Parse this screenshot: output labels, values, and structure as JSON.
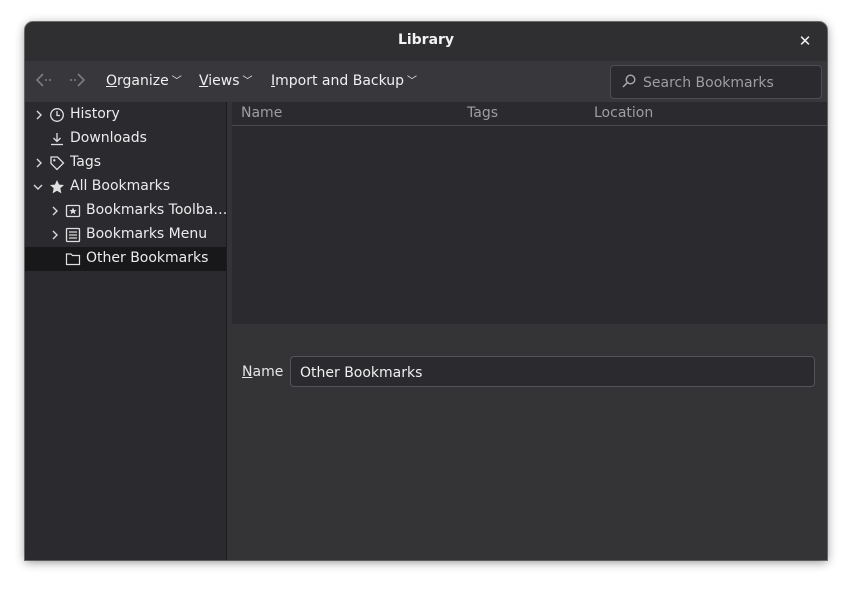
{
  "window": {
    "title": "Library"
  },
  "toolbar": {
    "organize": {
      "mnemonic": "O",
      "rest": "rganize"
    },
    "views": {
      "mnemonic": "V",
      "rest": "iews"
    },
    "import_backup": {
      "mnemonic": "I",
      "rest": "mport and Backup"
    },
    "search_placeholder": "Search Bookmarks"
  },
  "sidebar": {
    "items": [
      {
        "label": "History",
        "icon": "clock-icon",
        "expandable": true,
        "expanded": false
      },
      {
        "label": "Downloads",
        "icon": "download-icon",
        "expandable": false
      },
      {
        "label": "Tags",
        "icon": "tag-icon",
        "expandable": true,
        "expanded": false
      },
      {
        "label": "All Bookmarks",
        "icon": "star-icon",
        "expandable": true,
        "expanded": true
      },
      {
        "label": "Bookmarks Toolba…",
        "icon": "bookmarks-toolbar-icon",
        "expandable": true,
        "expanded": false
      },
      {
        "label": "Bookmarks Menu",
        "icon": "bookmarks-menu-icon",
        "expandable": true,
        "expanded": false
      },
      {
        "label": "Other Bookmarks",
        "icon": "folder-icon",
        "expandable": false,
        "selected": true
      }
    ]
  },
  "list": {
    "columns": [
      "Name",
      "Tags",
      "Location"
    ],
    "rows": []
  },
  "details": {
    "name_label": {
      "mnemonic": "N",
      "rest": "ame"
    },
    "name_value": "Other Bookmarks"
  },
  "colors": {
    "window_bg": "#2b2a2e",
    "toolbar_bg": "#38373b",
    "selected_row": "#18171a",
    "text": "#e6e6e6"
  }
}
